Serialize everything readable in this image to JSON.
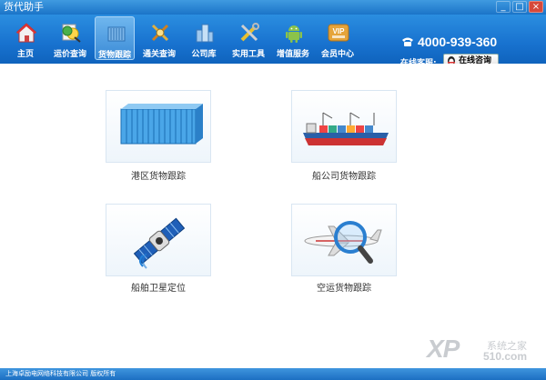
{
  "window": {
    "title": "货代助手",
    "controls": [
      "_",
      "□",
      "×"
    ]
  },
  "nav": {
    "items": [
      {
        "label": "主页",
        "icon": "home-icon"
      },
      {
        "label": "运价查询",
        "icon": "freight-rate-search-icon"
      },
      {
        "label": "货物跟踪",
        "icon": "cargo-tracking-icon",
        "active": true
      },
      {
        "label": "通关查询",
        "icon": "customs-query-icon"
      },
      {
        "label": "公司库",
        "icon": "company-library-icon"
      },
      {
        "label": "实用工具",
        "icon": "tools-icon"
      },
      {
        "label": "增值服务",
        "icon": "android-icon"
      },
      {
        "label": "会员中心",
        "icon": "vip-member-icon"
      }
    ],
    "vip_badge": "VIP"
  },
  "contact": {
    "phone": "4000-939-360",
    "service_label": "在线客服:",
    "consult_button": "在线咨询"
  },
  "tiles": [
    {
      "label": "港区货物跟踪",
      "icon": "container-icon"
    },
    {
      "label": "船公司货物跟踪",
      "icon": "cargo-ship-icon"
    },
    {
      "label": "船舶卫星定位",
      "icon": "satellite-icon"
    },
    {
      "label": "空运货物跟踪",
      "icon": "airplane-magnifier-icon"
    }
  ],
  "status": {
    "copyright": "上海卓励电网络科技有限公司 版权所有"
  },
  "watermark": {
    "brand": "XP",
    "site": "系统之家",
    "number": "510.com"
  },
  "colors": {
    "toolbar_blue": "#1872cf",
    "active_tab": "#5aa5e6",
    "tile_border": "#d9e6f2"
  }
}
